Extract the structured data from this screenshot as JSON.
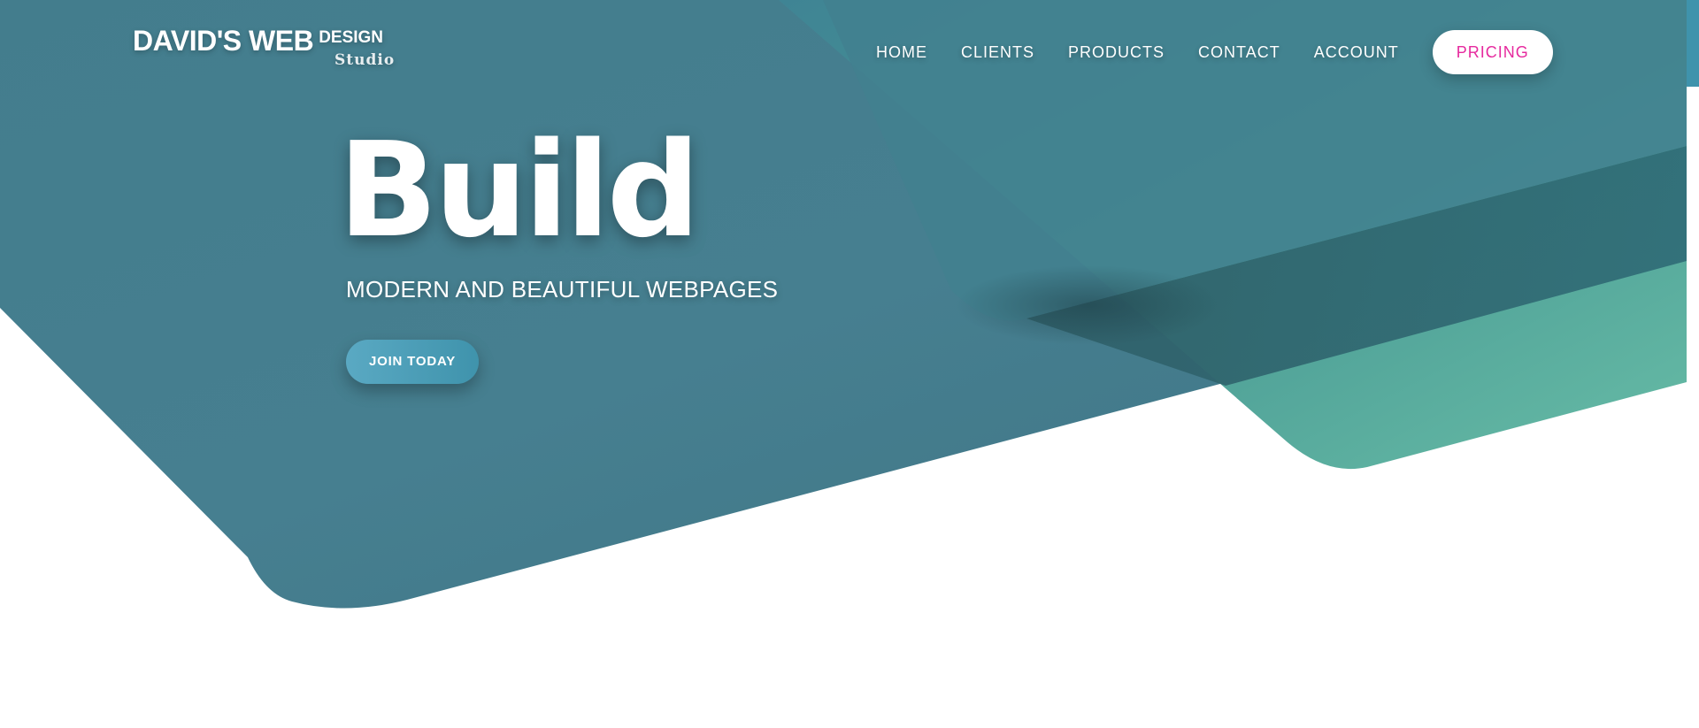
{
  "logo": {
    "main": "DAVID'S WEB",
    "design": "DESIGN",
    "studio": "Studio"
  },
  "nav": {
    "items": [
      {
        "label": "HOME"
      },
      {
        "label": "CLIENTS"
      },
      {
        "label": "PRODUCTS"
      },
      {
        "label": "CONTACT"
      },
      {
        "label": "ACCOUNT"
      }
    ],
    "cta_label": "PRICING"
  },
  "hero": {
    "title": "Build",
    "subtitle": "MODERN AND BEAUTIFUL WEBPAGES",
    "button_label": "JOIN TODAY"
  },
  "colors": {
    "hero_teal": "#4a8596",
    "accent_green": "#5bb7a0",
    "pricing_text": "#e6299e",
    "button_blue": "#4a9db7"
  }
}
